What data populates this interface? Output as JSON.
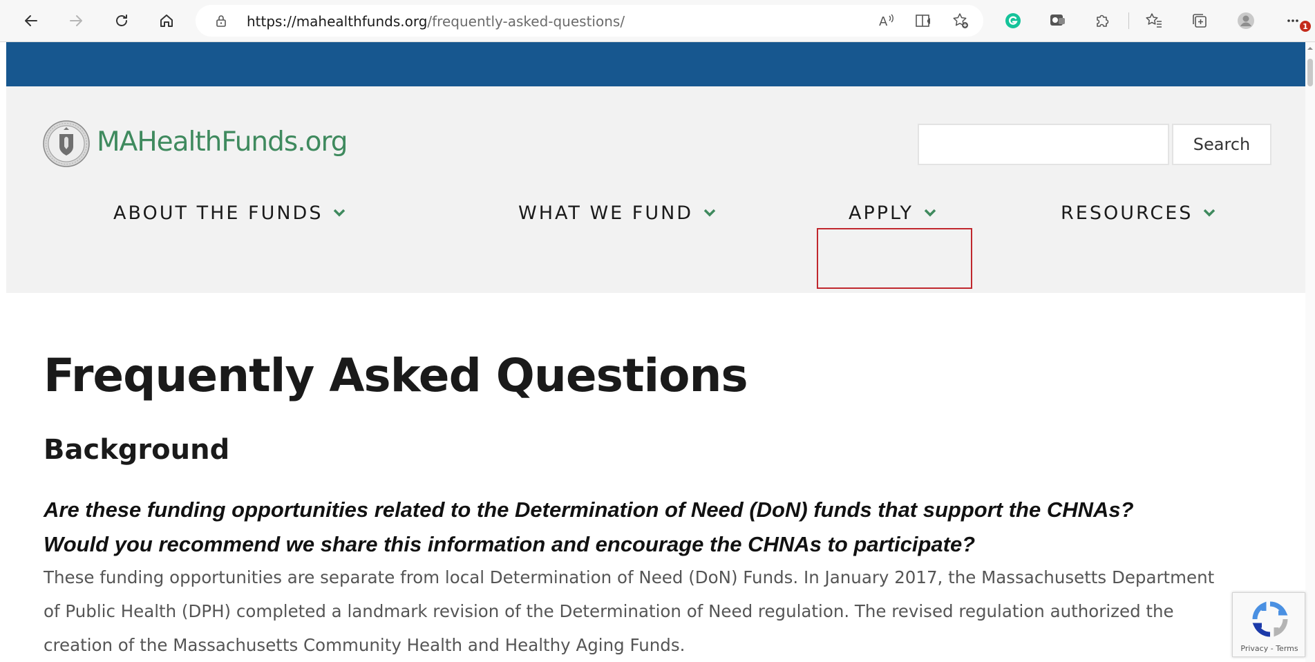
{
  "browser": {
    "url_host": "https://mahealthfunds.org",
    "url_path": "/frequently-asked-questions/",
    "notification_badge": "1"
  },
  "site": {
    "logo_text": "MAHealthFunds.org",
    "search_button_label": "Search",
    "search_placeholder": "",
    "nav": {
      "about": "ABOUT THE FUNDS",
      "what_we_fund": "WHAT WE FUND",
      "apply": "APPLY",
      "resources": "RESOURCES"
    },
    "colors": {
      "top_strip": "#17578f",
      "logo_green": "#3f8a5e",
      "chevron_green": "#3f8a5e",
      "highlight_red": "#c0272d"
    }
  },
  "content": {
    "page_title": "Frequently Asked Questions",
    "section_title": "Background",
    "question_line1": "Are these funding opportunities related to the Determination of Need (DoN) funds that support the CHNAs?",
    "question_line2": "Would you recommend we share this information and encourage the CHNAs to participate?",
    "answer_line1": "These funding opportunities are separate from local Determination of Need (DoN) Funds. In January 2017, the Massachusetts Department",
    "answer_line2": "of Public Health (DPH) completed a landmark revision of the Determination of Need regulation. The revised regulation authorized the",
    "answer_line3": "creation of the Massachusetts Community Health and Healthy Aging Funds."
  },
  "recaptcha": {
    "label": "Privacy - Terms"
  }
}
